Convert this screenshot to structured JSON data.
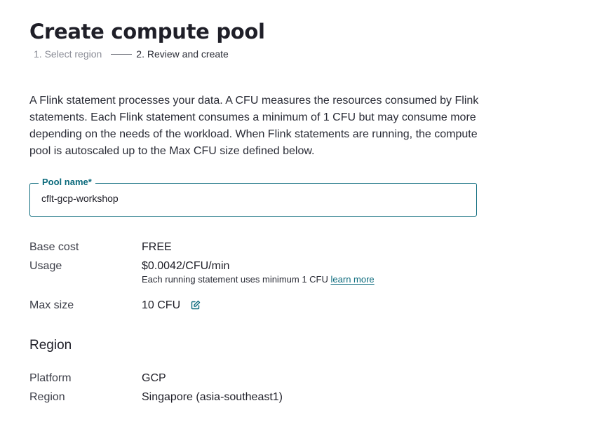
{
  "page": {
    "title": "Create compute pool"
  },
  "steps": [
    {
      "label": "1. Select region",
      "state": "completed"
    },
    {
      "label": "2. Review and create",
      "state": "active"
    }
  ],
  "intro": "A Flink statement processes your data. A CFU measures the resources consumed by Flink statements. Each Flink statement consumes a minimum of 1 CFU but may consume more depending on the needs of the workload. When Flink statements are running, the compute pool is autoscaled up to the Max CFU size defined below.",
  "pool_name": {
    "label": "Pool name*",
    "value": "cflt-gcp-workshop"
  },
  "details": {
    "base_cost": {
      "label": "Base cost",
      "value": "FREE"
    },
    "usage": {
      "label": "Usage",
      "value": "$0.0042/CFU/min",
      "note": "Each running statement uses minimum 1 CFU",
      "link": "learn more"
    },
    "max_size": {
      "label": "Max size",
      "value": "10 CFU",
      "icon": "edit-icon"
    }
  },
  "region_section": {
    "heading": "Region",
    "platform": {
      "label": "Platform",
      "value": "GCP"
    },
    "region": {
      "label": "Region",
      "value": "Singapore (asia-southeast1)"
    }
  },
  "colors": {
    "accent": "#0b6a7c",
    "text": "#1f1f28",
    "muted": "#8a8c96"
  }
}
